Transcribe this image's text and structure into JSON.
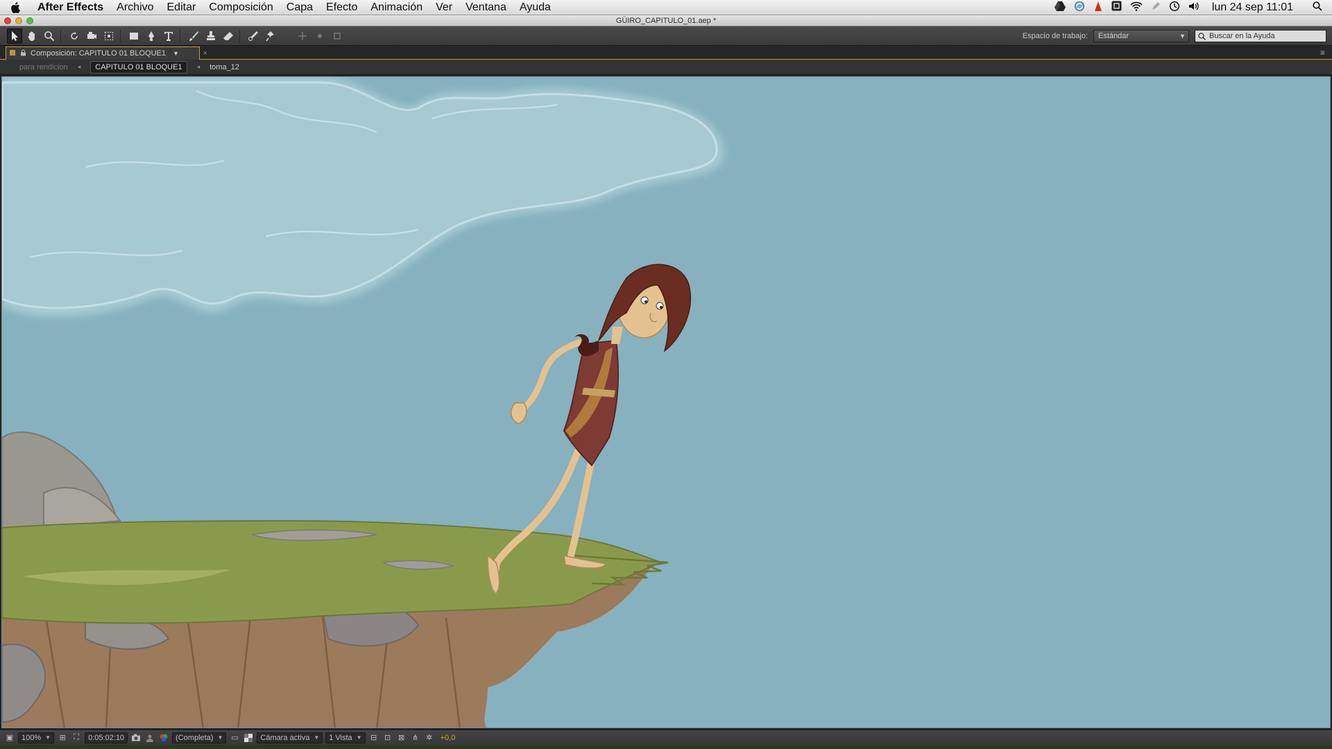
{
  "menubar": {
    "app_name": "After Effects",
    "items": [
      "Archivo",
      "Editar",
      "Composición",
      "Capa",
      "Efecto",
      "Animación",
      "Ver",
      "Ventana",
      "Ayuda"
    ],
    "clock": "lun 24 sep  11:01"
  },
  "window": {
    "title": "GÜIRO_CAPITULO_01.aep *"
  },
  "toolbar": {
    "tools": [
      "selection-tool",
      "hand-tool",
      "zoom-tool",
      "rotate-tool",
      "camera-orbit-tool",
      "pan-behind-tool",
      "rectangle-tool",
      "pen-tool",
      "type-tool",
      "brush-tool",
      "clone-stamp-tool",
      "eraser-tool",
      "roto-brush-tool",
      "puppet-pin-tool"
    ],
    "workspace_label": "Espacio de trabajo:",
    "workspace_value": "Estándar",
    "help_search_placeholder": "Buscar en la Ayuda"
  },
  "panel": {
    "tab_label": "Composición: CAPITULO 01 BLOQUE1",
    "breadcrumbs": [
      "para rendicion",
      "CAPITULO 01 BLOQUE1",
      "toma_12"
    ]
  },
  "viewer_bar": {
    "zoom": "100%",
    "timecode": "0:05:02:10",
    "resolution": "(Completa)",
    "camera": "Cámara activa",
    "views": "1 Vista",
    "exposure": "+0,0"
  },
  "colors": {
    "sky": "#87b1bf",
    "grass": "#8a9a4c",
    "cliff": "#9c7a5c",
    "skin": "#e4c28f",
    "tunic": "#7e3b34",
    "hair": "#6a2d22",
    "accent_border": "#c7a020"
  }
}
